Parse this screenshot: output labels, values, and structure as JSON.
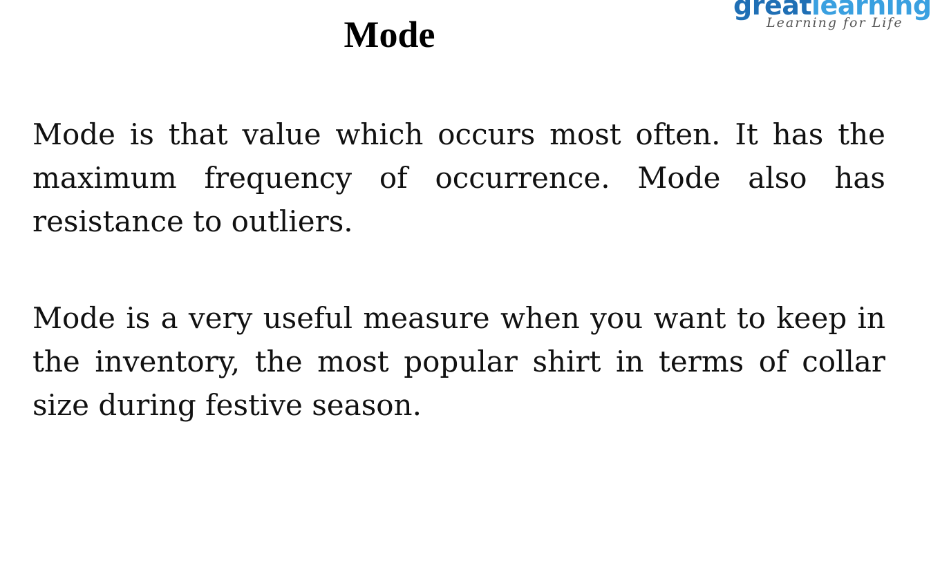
{
  "brand": {
    "logo_part1": "great",
    "logo_part2": "learning",
    "tagline": "Learning for Life",
    "colors": {
      "great": "#1f6fb5",
      "learning": "#3aa0e0"
    }
  },
  "slide": {
    "title": "Mode",
    "paragraphs": [
      "Mode is that value which occurs most often. It has the maximum frequency of occurrence. Mode also has resistance to outliers.",
      "Mode is a very useful measure when you want to keep in the inventory, the most popular shirt in terms of collar size during festive season."
    ]
  }
}
